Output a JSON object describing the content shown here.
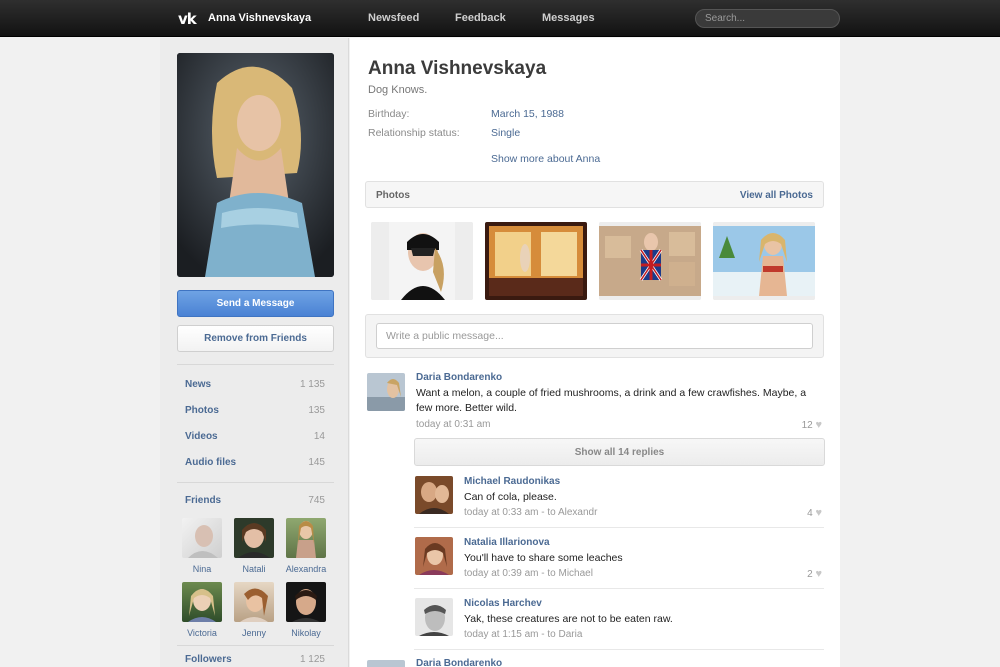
{
  "header": {
    "logo": "vk",
    "title": "Anna Vishnevskaya",
    "nav": [
      "Newsfeed",
      "Feedback",
      "Messages"
    ],
    "search_placeholder": "Search..."
  },
  "sidebar": {
    "send_message": "Send a Message",
    "remove_friend": "Remove from Friends",
    "counters": [
      {
        "label": "News",
        "count": "1 135"
      },
      {
        "label": "Photos",
        "count": "135"
      },
      {
        "label": "Videos",
        "count": "14"
      },
      {
        "label": "Audio files",
        "count": "145"
      }
    ],
    "friends": {
      "label": "Friends",
      "count": "745"
    },
    "friend_list": [
      "Nina",
      "Natali",
      "Alexandra",
      "Victoria",
      "Jenny",
      "Nikolay"
    ],
    "followers": {
      "label": "Followers",
      "count": "1 125"
    }
  },
  "profile": {
    "name": "Anna Vishnevskaya",
    "status": "Dog Knows.",
    "birthday_label": "Birthday:",
    "birthday": "March 15, 1988",
    "relationship_label": "Relationship status:",
    "relationship": "Single",
    "show_more": "Show more about Anna"
  },
  "photos": {
    "title": "Photos",
    "view_all": "View all Photos"
  },
  "composer": {
    "placeholder": "Write a public message..."
  },
  "wall": {
    "post": {
      "author": "Daria Bondarenko",
      "text": "Want a melon, a couple of fried mushrooms, a drink and a few crawfishes. Maybe, a few more. Better wild.",
      "time": "today at 0:31 am",
      "likes": "12"
    },
    "show_replies": "Show all 14 replies",
    "replies": [
      {
        "author": "Michael Raudonikas",
        "text": "Can of cola, please.",
        "time": "today at 0:33 am - to Alexandr",
        "likes": "4"
      },
      {
        "author": "Natalia Illarionova",
        "text": "You'll have to share some leaches",
        "time": "today at 0:39 am - to Michael",
        "likes": "2"
      },
      {
        "author": "Nicolas Harchev",
        "text": "Yak, these creatures are not to be eaten raw.",
        "time": "today at 1:15 am - to Daria",
        "likes": ""
      }
    ],
    "next_author": "Daria Bondarenko"
  },
  "colors": {
    "link": "#4b6a93",
    "button": "#4a82d4",
    "topbar": "#1d1d1d"
  },
  "icons": {
    "like": "heart-icon"
  }
}
